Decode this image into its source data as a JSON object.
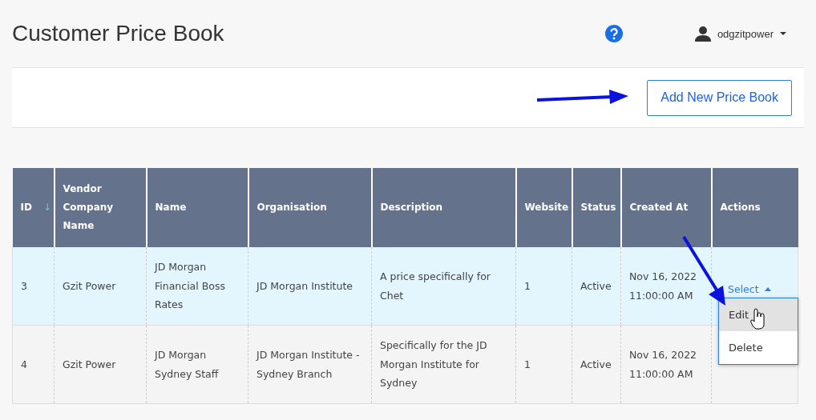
{
  "header": {
    "title": "Customer Price Book",
    "user": "odgzitpower"
  },
  "toolbar": {
    "add_button": "Add New Price Book"
  },
  "table": {
    "columns": [
      {
        "label": "ID",
        "sort": "↓"
      },
      {
        "label": "Vendor Company Name"
      },
      {
        "label": "Name"
      },
      {
        "label": "Organisation"
      },
      {
        "label": "Description"
      },
      {
        "label": "Website"
      },
      {
        "label": "Status"
      },
      {
        "label": "Created At"
      },
      {
        "label": "Actions"
      }
    ],
    "rows": [
      {
        "selected": true,
        "cells": [
          "3",
          "Gzit Power",
          "JD Morgan Financial Boss Rates",
          "JD Morgan Institute",
          "A price specifically for Chet",
          "1",
          "Active",
          "Nov 16, 2022 11:00:00 AM"
        ],
        "action": "Select",
        "expanded": true
      },
      {
        "selected": false,
        "cells": [
          "4",
          "Gzit Power",
          "JD Morgan Sydney Staff",
          "JD Morgan Institute - Sydney Branch",
          "Specifically for the JD Morgan Institute for Sydney",
          "1",
          "Active",
          "Nov 16, 2022 11:00:00 AM"
        ]
      }
    ]
  },
  "action_menu": {
    "items": [
      {
        "label": "Edit",
        "selected": true
      },
      {
        "label": "Delete",
        "selected": false
      }
    ]
  }
}
